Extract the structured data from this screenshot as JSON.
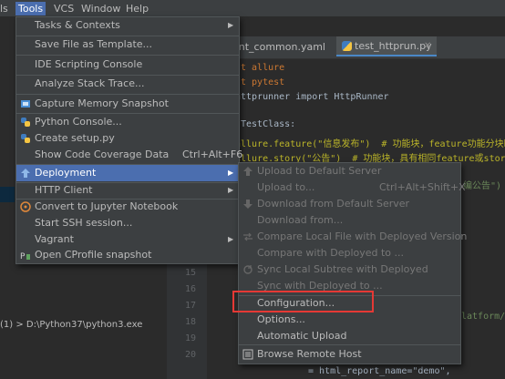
{
  "menubar": {
    "items": [
      {
        "label": "ls"
      },
      {
        "label": "Tools"
      },
      {
        "label": "VCS"
      },
      {
        "label": "Window"
      },
      {
        "label": "Help"
      }
    ]
  },
  "editor": {
    "tabs": [
      {
        "label": "ent_common.yaml"
      },
      {
        "label": "test_httprun.py"
      }
    ],
    "code_lines": [
      "t allure",
      "t pytest",
      "httprunner import HttpRunner",
      "TestClass:",
      "allure.feature(\"信息发布\")  # 功能块，feature功能分块时比s",
      "allure.story(\"公告\")  # 功能块，具有相同feature或story的用",
      "编公告\")",
      "latform/02_",
      "= html_report_name=\"demo\","
    ],
    "line_numbers": [
      "15",
      "16",
      "17",
      "18",
      "19",
      "20"
    ]
  },
  "left_panel": {
    "path_text": "(1) > D:\\Python37\\python3.exe"
  },
  "tools_menu": {
    "items": [
      {
        "label": "Tasks & Contexts",
        "submenu": true
      },
      {
        "label": "Save File as Template..."
      },
      {
        "label": "IDE Scripting Console"
      },
      {
        "label": "Analyze Stack Trace..."
      },
      {
        "label": "Capture Memory Snapshot",
        "icon": "memory-icon"
      },
      {
        "label": "Python Console...",
        "icon": "python-icon"
      },
      {
        "label": "Create setup.py",
        "icon": "python-icon"
      },
      {
        "label": "Show Code Coverage Data",
        "shortcut": "Ctrl+Alt+F6"
      },
      {
        "label": "Deployment",
        "submenu": true,
        "icon": "upload-icon",
        "highlighted": true
      },
      {
        "label": "HTTP Client",
        "submenu": true
      },
      {
        "label": "Convert to Jupyter Notebook",
        "icon": "notebook-icon"
      },
      {
        "label": "Start SSH session..."
      },
      {
        "label": "Vagrant",
        "submenu": true
      },
      {
        "label": "Open CProfile snapshot",
        "icon": "profile-icon"
      }
    ]
  },
  "deployment_submenu": {
    "items": [
      {
        "label": "Upload to Default Server",
        "enabled": false,
        "icon": "upload-icon"
      },
      {
        "label": "Upload to...",
        "shortcut": "Ctrl+Alt+Shift+X",
        "enabled": false
      },
      {
        "label": "Download from Default Server",
        "enabled": false,
        "icon": "download-icon"
      },
      {
        "label": "Download from...",
        "enabled": false
      },
      {
        "label": "Compare Local File with Deployed Version",
        "enabled": false,
        "icon": "compare-icon"
      },
      {
        "label": "Compare with Deployed to ...",
        "enabled": false
      },
      {
        "label": "Sync Local Subtree with Deployed",
        "enabled": false,
        "icon": "sync-icon"
      },
      {
        "label": "Sync with Deployed to ...",
        "enabled": false
      },
      {
        "label": "Configuration...",
        "enabled": true
      },
      {
        "label": "Options...",
        "enabled": true
      },
      {
        "label": "Automatic Upload",
        "enabled": true
      },
      {
        "label": "Browse Remote Host",
        "enabled": true,
        "icon": "remote-host-icon"
      }
    ]
  },
  "annotation": {
    "highlight_color": "#e53935"
  }
}
